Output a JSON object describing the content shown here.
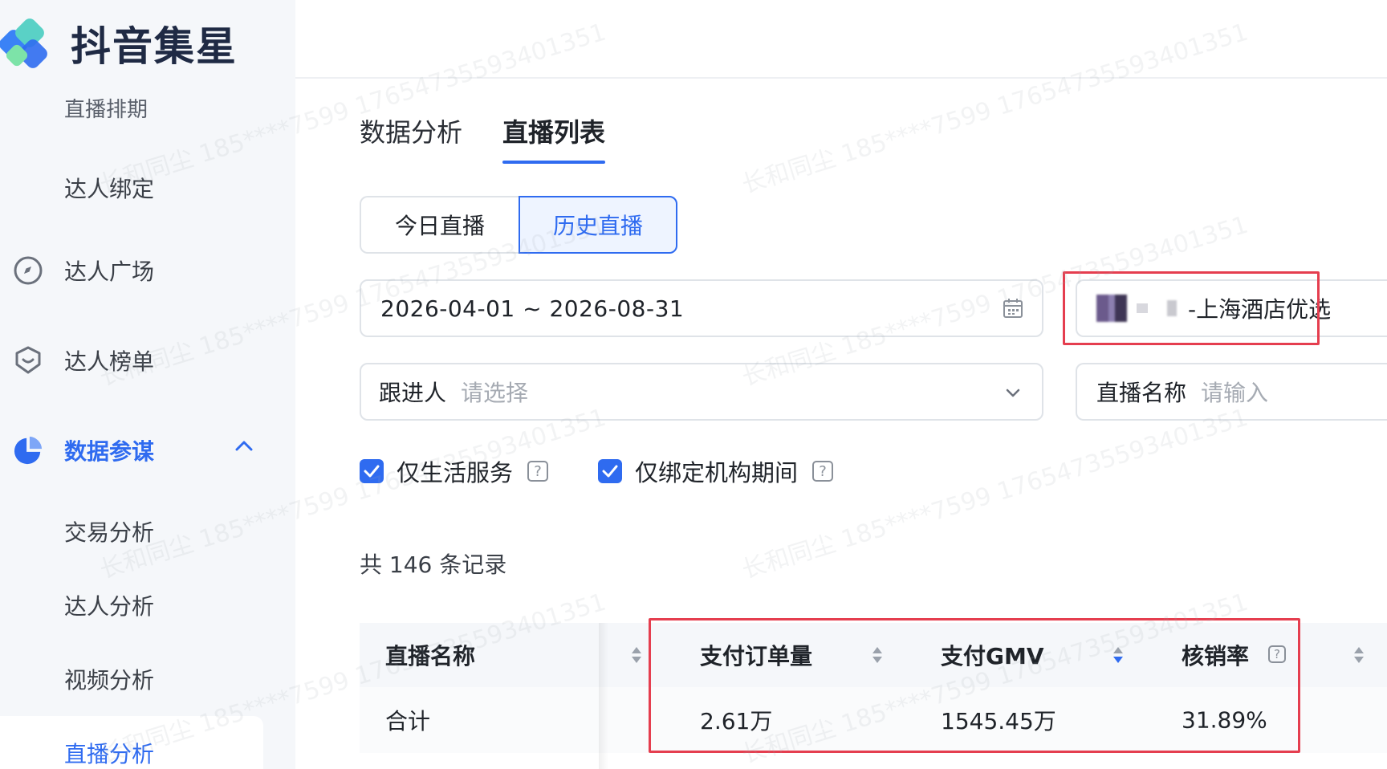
{
  "brand": {
    "name": "抖音集星"
  },
  "sidebar": {
    "items": [
      {
        "label": "直播排期"
      },
      {
        "label": "达人绑定"
      },
      {
        "label": "达人广场",
        "icon": "compass-icon"
      },
      {
        "label": "达人榜单",
        "icon": "badge-icon"
      },
      {
        "label": "数据参谋",
        "icon": "pie-chart-icon",
        "expanded": true
      },
      {
        "label": "交易分析"
      },
      {
        "label": "达人分析"
      },
      {
        "label": "视频分析"
      },
      {
        "label": "直播分析",
        "active": true
      }
    ]
  },
  "tabs": [
    {
      "label": "数据分析"
    },
    {
      "label": "直播列表",
      "active": true
    }
  ],
  "segment": {
    "today": "今日直播",
    "history": "历史直播",
    "selected": "历史直播"
  },
  "filters": {
    "date_range": "2026-04-01 ~ 2026-08-31",
    "shop_value": "-上海酒店优选",
    "follower_label": "跟进人",
    "follower_placeholder": "请选择",
    "live_name_label": "直播名称",
    "live_name_placeholder": "请输入"
  },
  "checkboxes": [
    {
      "label": "仅生活服务",
      "checked": true
    },
    {
      "label": "仅绑定机构期间",
      "checked": true
    }
  ],
  "record_count": "共 146 条记录",
  "table": {
    "headers": [
      "直播名称",
      "支付订单量",
      "支付GMV",
      "核销率"
    ],
    "summary_row": [
      "合计",
      "2.61万",
      "1545.45万",
      "31.89%"
    ]
  },
  "watermark": "长和同尘 185****7599 17654735593401351",
  "colors": {
    "accent": "#2f6bf0",
    "highlight": "#e53e4f"
  }
}
